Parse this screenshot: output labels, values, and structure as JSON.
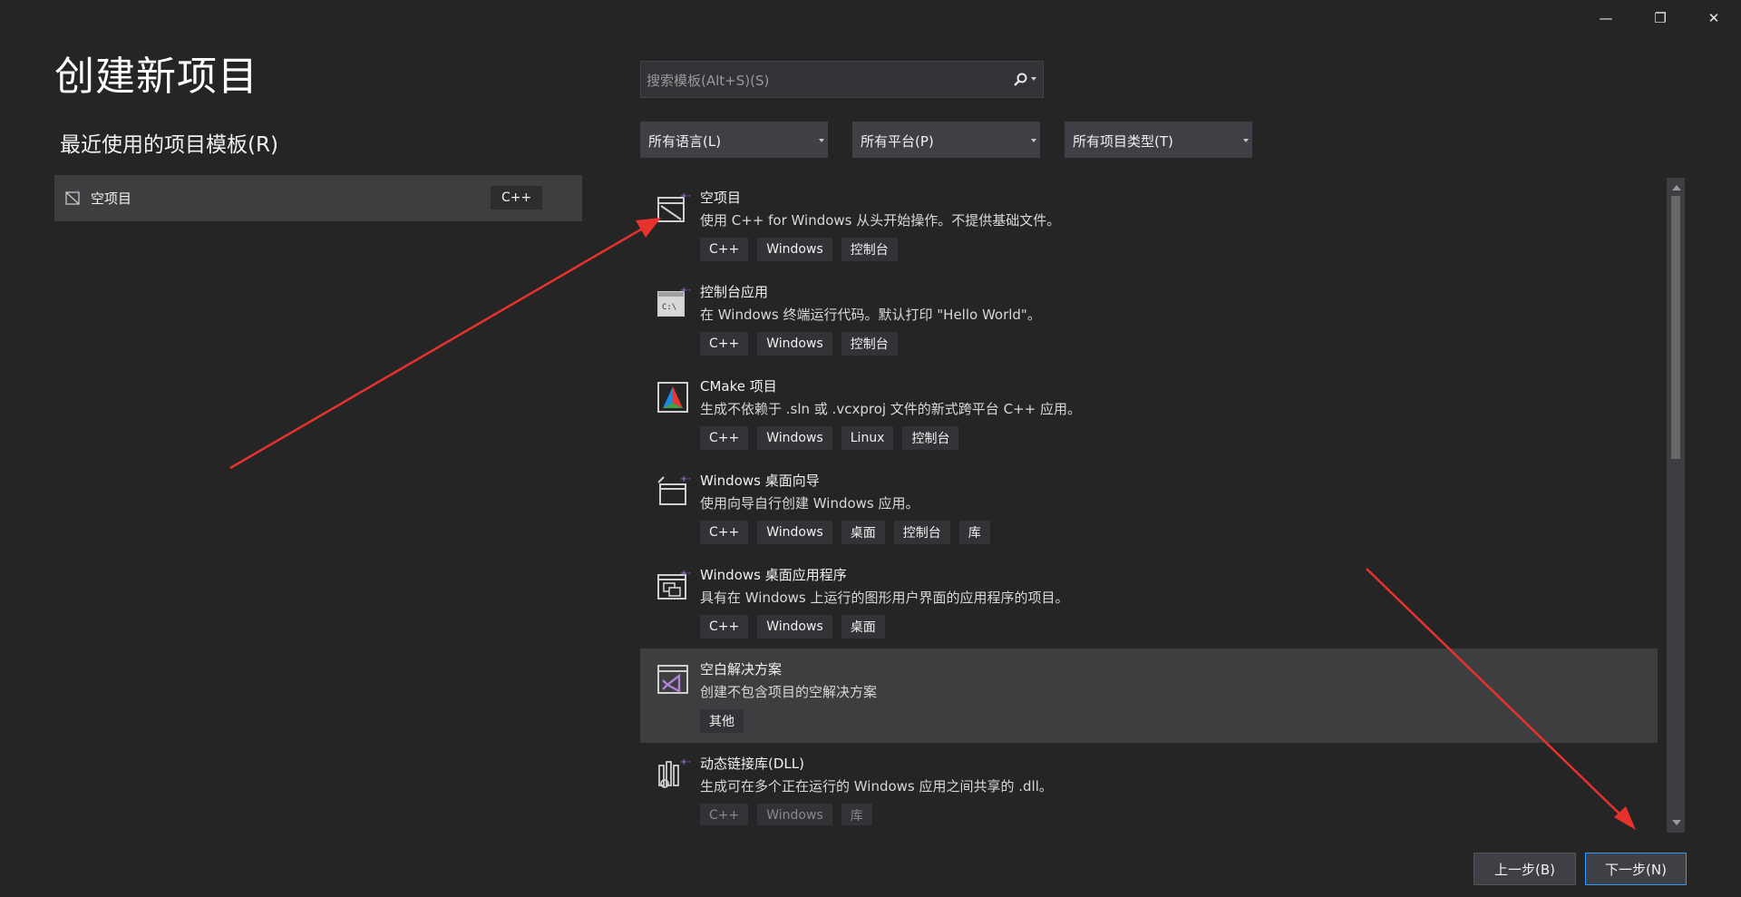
{
  "window": {
    "minimize_glyph": "—",
    "maximize_glyph": "❐",
    "close_glyph": "✕"
  },
  "page_title": "创建新项目",
  "recent": {
    "title": "最近使用的项目模板(R)",
    "items": [
      {
        "label": "空项目",
        "tag": "C++",
        "icon": "empty-project-icon"
      }
    ]
  },
  "search": {
    "placeholder": "搜索模板(Alt+S)(S)",
    "value": ""
  },
  "filters": [
    {
      "label": "所有语言(L)"
    },
    {
      "label": "所有平台(P)"
    },
    {
      "label": "所有项目类型(T)"
    }
  ],
  "templates": [
    {
      "name": "空项目",
      "desc": "使用 C++ for Windows 从头开始操作。不提供基础文件。",
      "tags": [
        "C++",
        "Windows",
        "控制台"
      ],
      "icon": "empty-project-icon"
    },
    {
      "name": "控制台应用",
      "desc": "在 Windows 终端运行代码。默认打印 \"Hello World\"。",
      "tags": [
        "C++",
        "Windows",
        "控制台"
      ],
      "icon": "console-app-icon"
    },
    {
      "name": "CMake 项目",
      "desc": "生成不依赖于 .sln 或 .vcxproj 文件的新式跨平台 C++ 应用。",
      "tags": [
        "C++",
        "Windows",
        "Linux",
        "控制台"
      ],
      "icon": "cmake-icon"
    },
    {
      "name": "Windows 桌面向导",
      "desc": "使用向导自行创建 Windows 应用。",
      "tags": [
        "C++",
        "Windows",
        "桌面",
        "控制台",
        "库"
      ],
      "icon": "desktop-wizard-icon"
    },
    {
      "name": "Windows 桌面应用程序",
      "desc": "具有在 Windows 上运行的图形用户界面的应用程序的项目。",
      "tags": [
        "C++",
        "Windows",
        "桌面"
      ],
      "icon": "desktop-app-icon"
    },
    {
      "name": "空白解决方案",
      "desc": "创建不包含项目的空解决方案",
      "tags": [
        "其他"
      ],
      "icon": "blank-solution-icon"
    },
    {
      "name": "动态链接库(DLL)",
      "desc": "生成可在多个正在运行的 Windows 应用之间共享的 .dll。",
      "tags": [
        "C++",
        "Windows",
        "库"
      ],
      "icon": "dll-icon"
    }
  ],
  "buttons": {
    "prev": "上一步(B)",
    "next": "下一步(N)"
  },
  "colors": {
    "background": "#252526",
    "selected_row": "#3e3e40",
    "accent": "#3399ff",
    "annotation_arrow": "#e8322e",
    "vs_purple": "#b180d7"
  }
}
